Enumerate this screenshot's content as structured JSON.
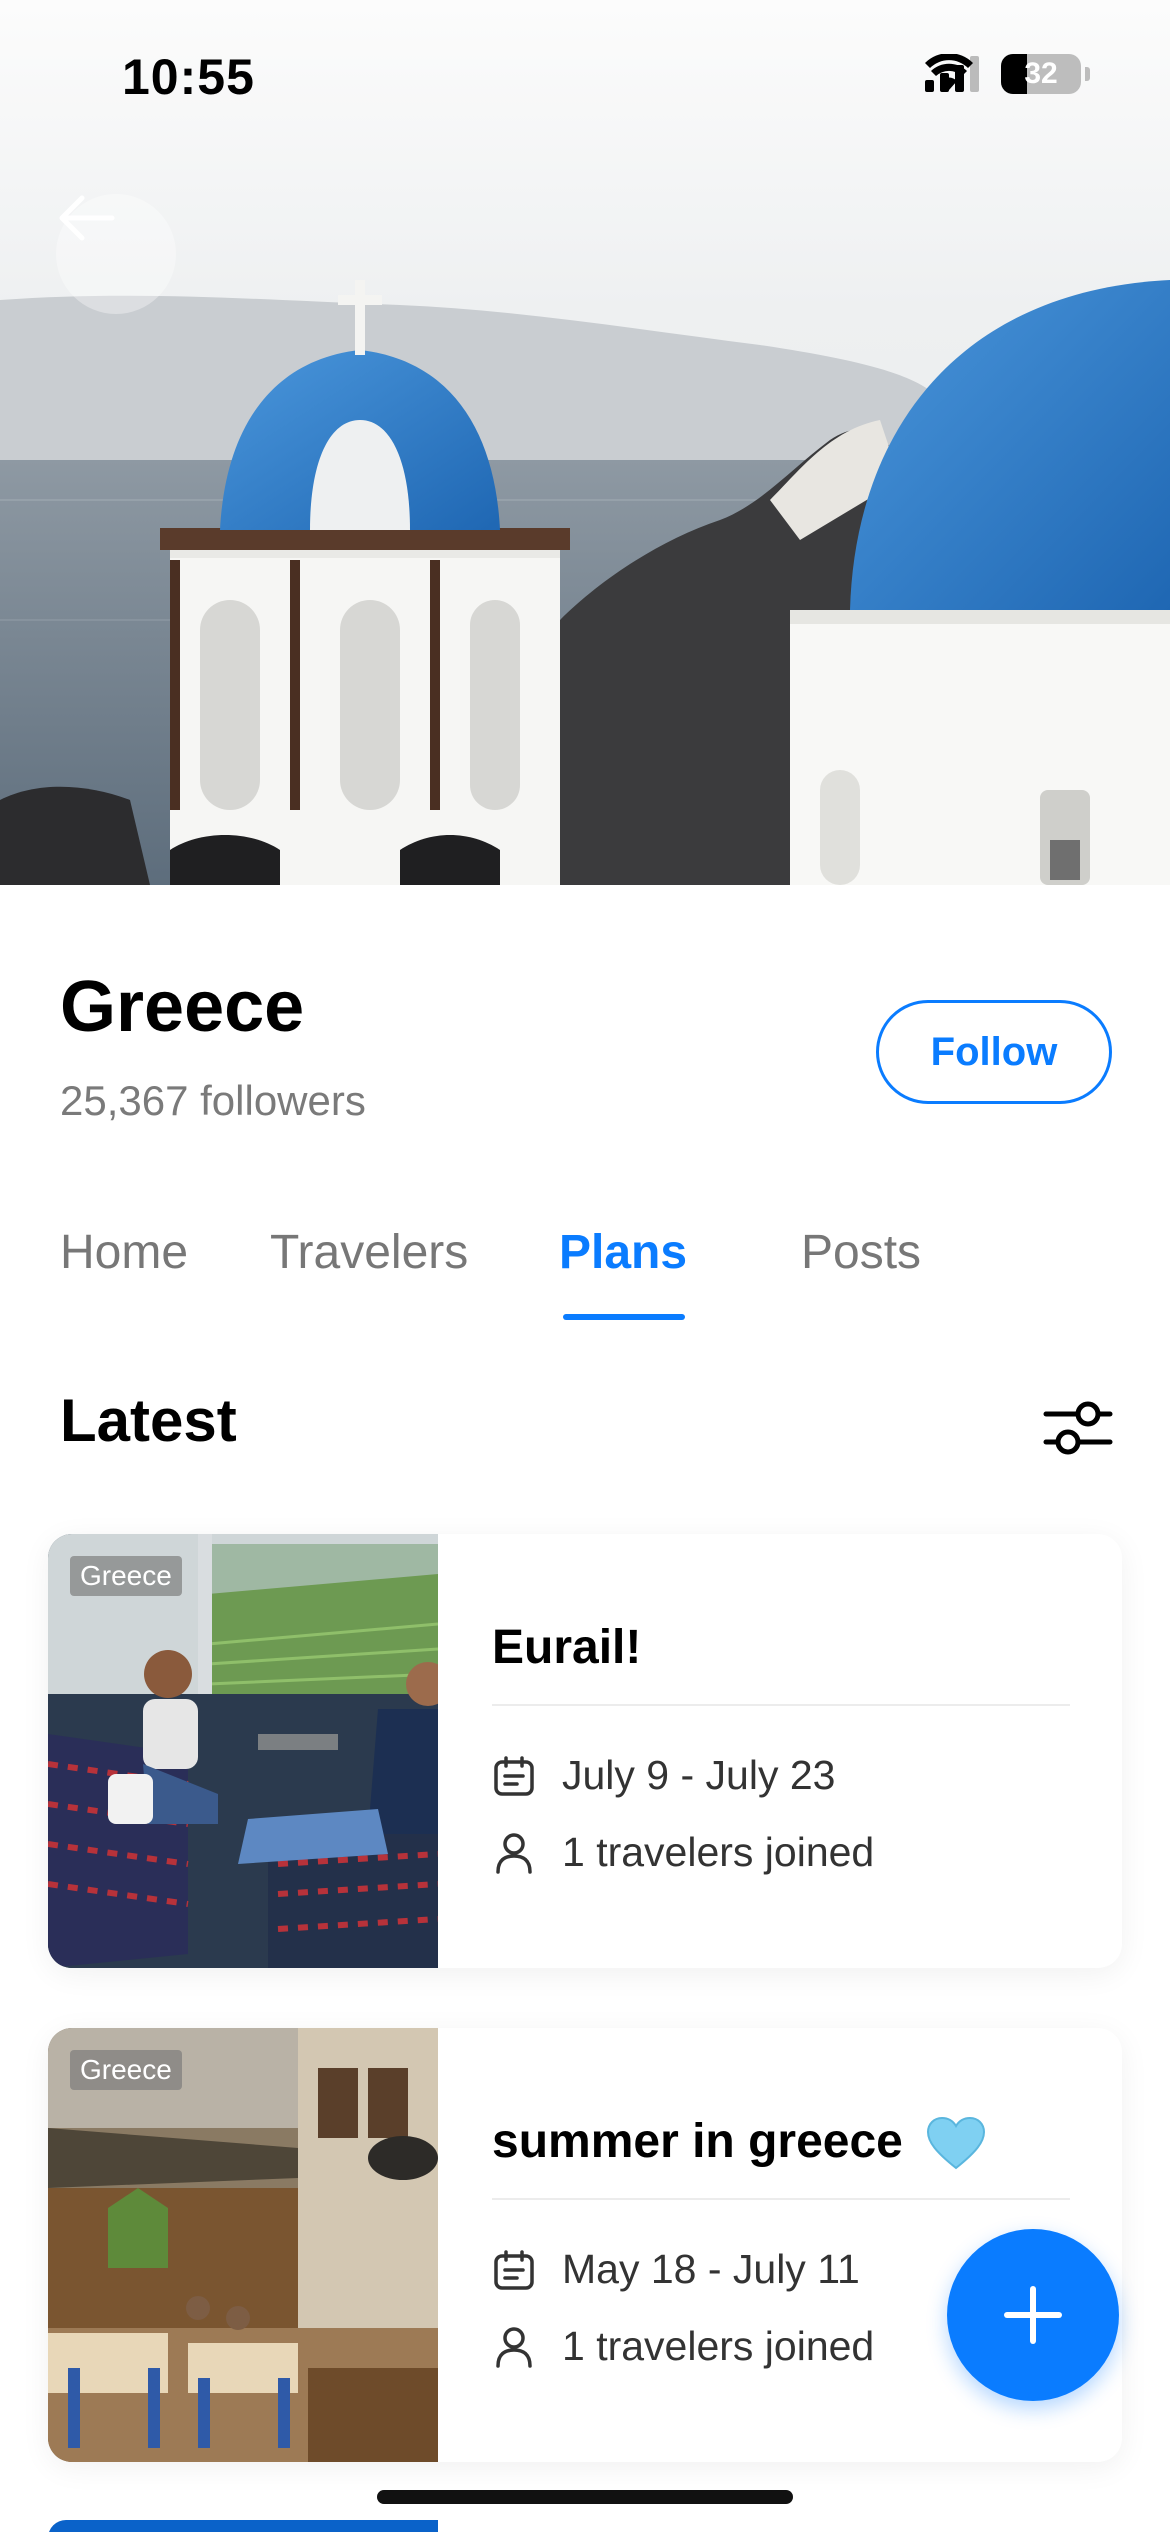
{
  "status_bar": {
    "time": "10:55",
    "battery": "32"
  },
  "hero": {
    "back_icon": "arrow-left-icon"
  },
  "profile": {
    "title": "Greece",
    "followers": "25,367 followers",
    "follow_label": "Follow"
  },
  "tabs": [
    {
      "label": "Home"
    },
    {
      "label": "Travelers"
    },
    {
      "label": "Plans",
      "active": true
    },
    {
      "label": "Posts"
    }
  ],
  "section": {
    "title": "Latest",
    "filter_icon": "sliders-icon"
  },
  "plans": [
    {
      "badge": "Greece",
      "title": "Eurail!",
      "dates": "July 9 - July 23",
      "joined": "1 travelers joined"
    },
    {
      "badge": "Greece",
      "title": "summer in greece",
      "emoji": "light-blue-heart",
      "dates": "May 18 - July 11",
      "joined": "1 travelers joined"
    }
  ],
  "fab": {
    "icon": "plus-icon"
  },
  "colors": {
    "accent": "#0a7cff",
    "dome_blue": "#2f7fcc",
    "muted_text": "#7a7a7a"
  }
}
